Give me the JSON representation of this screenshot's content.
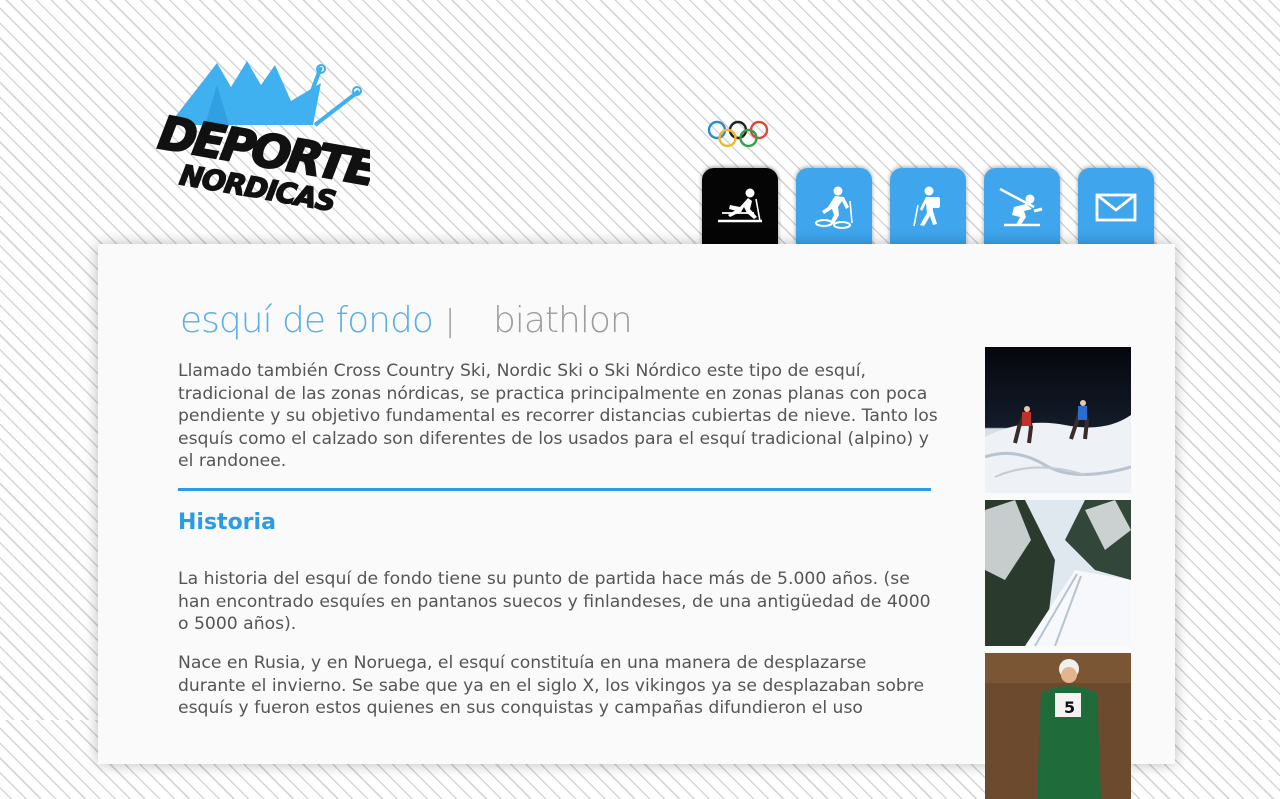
{
  "brand": {
    "logo_line1": "DEPORTES",
    "logo_line2": "NORDICAS"
  },
  "nav": {
    "items": [
      {
        "icon": "cross-country-skier-icon",
        "active": true
      },
      {
        "icon": "snowshoe-walker-icon",
        "active": false
      },
      {
        "icon": "hiker-icon",
        "active": false
      },
      {
        "icon": "biathlete-shooting-icon",
        "active": false
      },
      {
        "icon": "mail-icon",
        "active": false
      }
    ]
  },
  "tabs": {
    "active": "esquí de fondo",
    "separator": "|",
    "other": "biathlon"
  },
  "content": {
    "intro": "Llamado también Cross Country Ski, Nordic Ski o Ski Nórdico este tipo de esquí, tradicional de las zonas nórdicas, se practica principalmente en zonas planas con poca pendiente y su objetivo fundamental es recorrer distancias cubiertas de nieve. Tanto los esquís como el calzado son diferentes de los usados para el esquí tradicional (alpino) y el randonee.",
    "section_title": "Historia",
    "para1": "La historia del esquí de fondo tiene su punto de partida hace más de 5.000 años. (se han encontrado esquíes en pantanos suecos y finlandeses, de una antigüedad de 4000 o 5000 años).",
    "para2": "Nace en Rusia, y en Noruega, el esquí constituía en una manera de desplazarse durante el invierno. Se sabe que ya en el siglo X, los vikingos ya se desplazaban sobre esquís y fueron estos quienes en sus conquistas y campañas difundieron el uso"
  },
  "photos": [
    {
      "name": "skiers-in-snow-photo"
    },
    {
      "name": "snowy-forest-trail-photo"
    },
    {
      "name": "racer-with-bib-photo",
      "bib_number": "5"
    }
  ],
  "colors": {
    "accent": "#3fa6ee",
    "heading": "#2b9be6",
    "active_nav": "#050505",
    "text": "#555555"
  }
}
